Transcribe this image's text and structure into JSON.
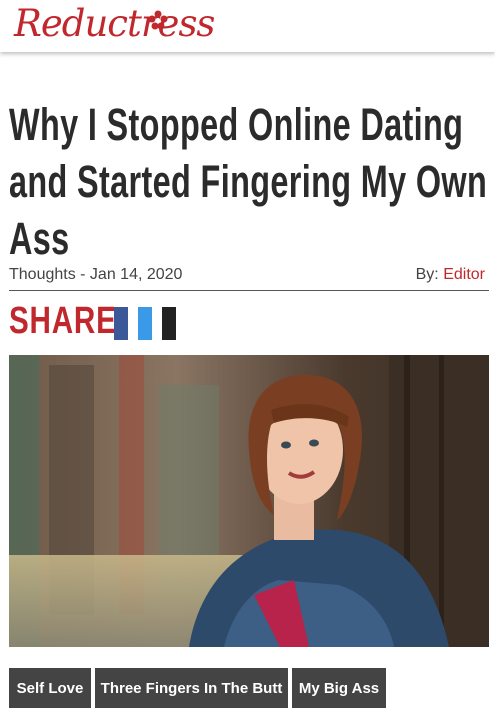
{
  "site": {
    "logo_text": "Reductress"
  },
  "article": {
    "title": "Why I Stopped Online Dating and Started Fingering My Own Ass",
    "category_date": "Thoughts - Jan 14, 2020",
    "by_label": "By:",
    "author": "Editor"
  },
  "share": {
    "label": "SHARE:",
    "buttons": [
      {
        "icon": "facebook-icon",
        "color": "#3b5998"
      },
      {
        "icon": "twitter-icon",
        "color": "#3a9ae8"
      },
      {
        "icon": "email-icon",
        "color": "#222222"
      }
    ]
  },
  "tags": [
    "Self Love",
    "Three Fingers In The Butt",
    "My Big Ass"
  ],
  "colors": {
    "brand": "#c0282d",
    "tag_bg": "#444444",
    "headline": "#2b2b2b"
  }
}
